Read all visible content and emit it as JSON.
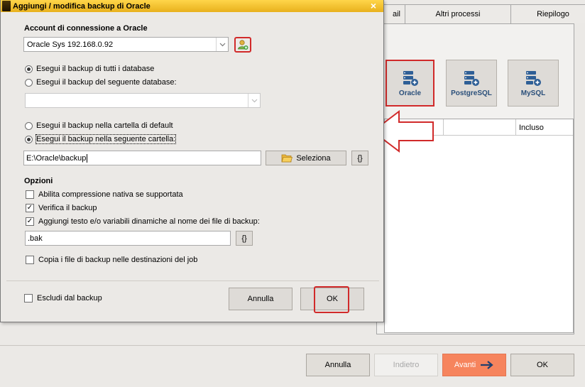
{
  "background": {
    "tabs": [
      "ail",
      "Altri processi",
      "Riepilogo"
    ],
    "db_buttons": [
      {
        "label": "Oracle",
        "icon": "database-add-icon"
      },
      {
        "label": "PostgreSQL",
        "icon": "database-add-icon"
      },
      {
        "label": "MySQL",
        "icon": "database-add-icon"
      }
    ],
    "grid_headers": [
      "",
      "Incluso"
    ],
    "footer": {
      "annulla": "Annulla",
      "indietro": "Indietro",
      "avanti": "Avanti",
      "ok": "OK"
    },
    "colors": {
      "avanti": "#f6845d",
      "highlight": "#d12a2a"
    }
  },
  "dialog": {
    "title": "Aggiungi / modifica backup di Oracle",
    "close_glyph": "×",
    "account_label": "Account di connessione a Oracle",
    "account_value": "Oracle Sys 192.168.0.92",
    "radio_all_db": "Esegui il backup di tutti i database",
    "radio_one_db": "Esegui il backup del seguente database:",
    "database_value": "",
    "radio_default_folder": "Esegui il backup nella cartella di default",
    "radio_custom_folder": "Esegui il backup nella seguente cartella:",
    "folder_value": "E:\\Oracle\\backup",
    "seleziona": "Seleziona",
    "vars_glyph": "{}",
    "options_label": "Opzioni",
    "opt_compression": "Abilita compressione nativa se supportata",
    "opt_verify": "Verifica  il backup",
    "opt_add_text": "Aggiungi testo e/o variabili dinamiche al nome dei file di backup:",
    "suffix_value": ".bak",
    "opt_copy": "Copia i file di backup nelle destinazioni del job",
    "exclude": "Escludi dal backup",
    "annulla": "Annulla",
    "ok": "OK"
  }
}
